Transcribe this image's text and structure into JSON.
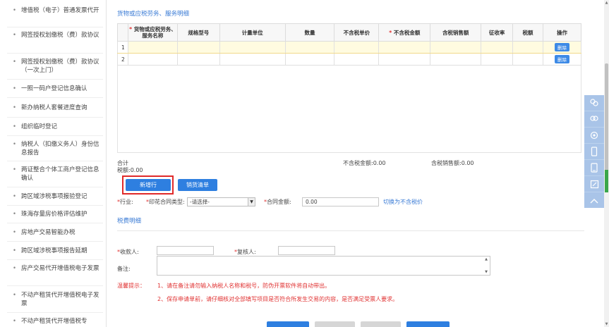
{
  "sidebar": {
    "items": [
      {
        "label": "增值税（电子）普通发票代开"
      },
      {
        "label": "网签授权划缴税（费）款协议"
      },
      {
        "label": "网签授权划缴税（费）款协议（一次上门）"
      },
      {
        "label": "一照一码户登记信息确认"
      },
      {
        "label": "新办纳税人套餐进度查询"
      },
      {
        "label": "组织临时登记"
      },
      {
        "label": "纳税人（扣缴义务人）身份信息报告"
      },
      {
        "label": "两证整合个体工商户登记信息确认"
      },
      {
        "label": "跨区域涉税事项报验登记"
      },
      {
        "label": "珠海存量房价格评估维护"
      },
      {
        "label": "房地产交易智能办税"
      },
      {
        "label": "跨区域涉税事项报告延期"
      },
      {
        "label": "房产交易代开增值税电子发票"
      },
      {
        "label": "不动产租赁代开增值税电子发票"
      },
      {
        "label": "不动产租赁代开增值税专"
      }
    ],
    "bullet": "•"
  },
  "goods_section": {
    "title": "货物或应税劳务、服务明细",
    "columns": [
      "",
      "货物或应税劳务、服务名称",
      "规格型号",
      "计量单位",
      "数量",
      "不含税单价",
      "不含税金额",
      "含税销售额",
      "征收率",
      "税额",
      "操作"
    ],
    "required_mark": "*",
    "rows": [
      {
        "index": "1",
        "action": "删除"
      },
      {
        "index": "2",
        "action": "删除"
      }
    ],
    "total_label": "合计",
    "tax_total": "税额:0.00",
    "net_total": "不含税金额:0.00",
    "gross_total": "含税销售额:0.00"
  },
  "buttons": {
    "add_row": "新增行",
    "sales_list": "销货清单"
  },
  "form": {
    "industry_label": "*行业:",
    "contract_type_label": "*印花合同类型:",
    "contract_type_value": "-请选择-",
    "contract_amount_label": "*合同金额:",
    "contract_amount_value": "0.00",
    "convert_link": "切换为不含税价",
    "tax_detail_title": "税费明细",
    "payee_label": "*收款人:",
    "reviewer_label": "*复核人:",
    "remark_label": "备注:"
  },
  "tips": {
    "label": "温馨提示：",
    "line1": "1、请在备注请勿输入纳税人名称和税号，防伪开票软件将自动带出。",
    "line2": "2、保存申请单前，请仔细核对全部填写项目是否符合所发生交易的内容，是否满足受票人要求。"
  },
  "float_panel": {
    "icons": [
      "user-group-icon",
      "user-group-icon",
      "user-settings-icon",
      "mobile-icon",
      "tablet-icon",
      "edit-icon",
      "chevron-up-icon"
    ]
  },
  "colors": {
    "accent": "#2e7fe0",
    "link": "#3a7bd5",
    "warning": "#e03232",
    "row_highlight": "#fffbe0",
    "panel": "#a9c4e8"
  }
}
